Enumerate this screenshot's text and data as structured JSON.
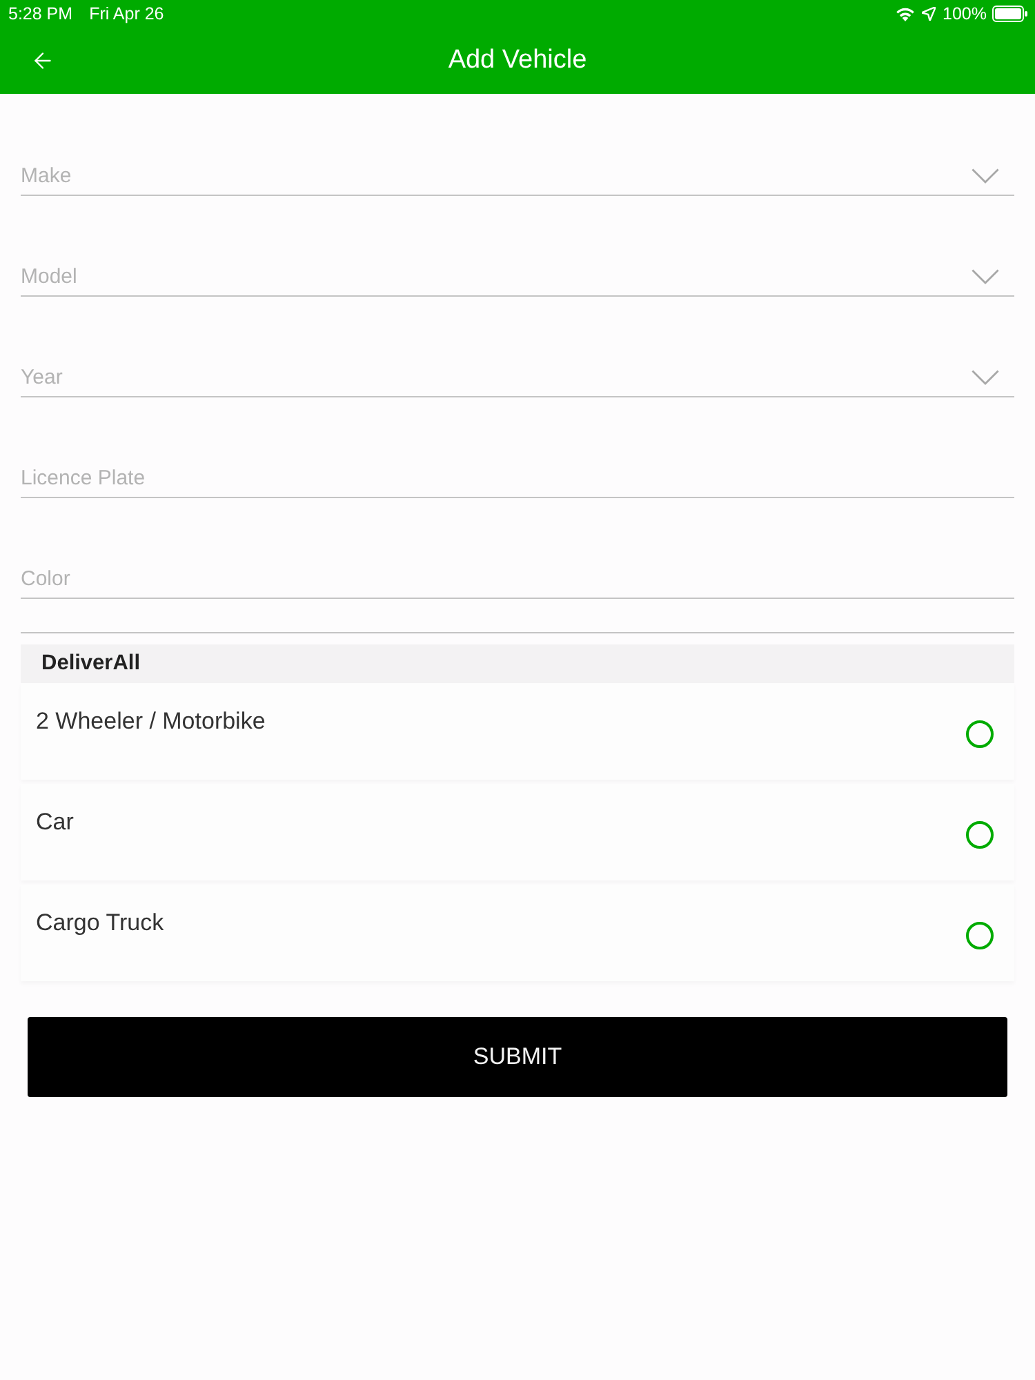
{
  "status_bar": {
    "time": "5:28 PM",
    "date": "Fri Apr 26",
    "battery": "100%"
  },
  "nav_bar": {
    "title": "Add Vehicle"
  },
  "form": {
    "fields": [
      {
        "kind": "dropdown",
        "placeholder": "Make"
      },
      {
        "kind": "dropdown",
        "placeholder": "Model"
      },
      {
        "kind": "dropdown",
        "placeholder": "Year"
      },
      {
        "kind": "text",
        "placeholder": "Licence Plate"
      },
      {
        "kind": "text",
        "placeholder": "Color"
      }
    ]
  },
  "vehicle_types": {
    "section": "DeliverAll",
    "options": [
      {
        "label": "2 Wheeler / Motorbike",
        "selected": false
      },
      {
        "label": "Car",
        "selected": false
      },
      {
        "label": "Cargo Truck",
        "selected": false
      }
    ]
  },
  "submit_button": {
    "label": "SUBMIT"
  }
}
